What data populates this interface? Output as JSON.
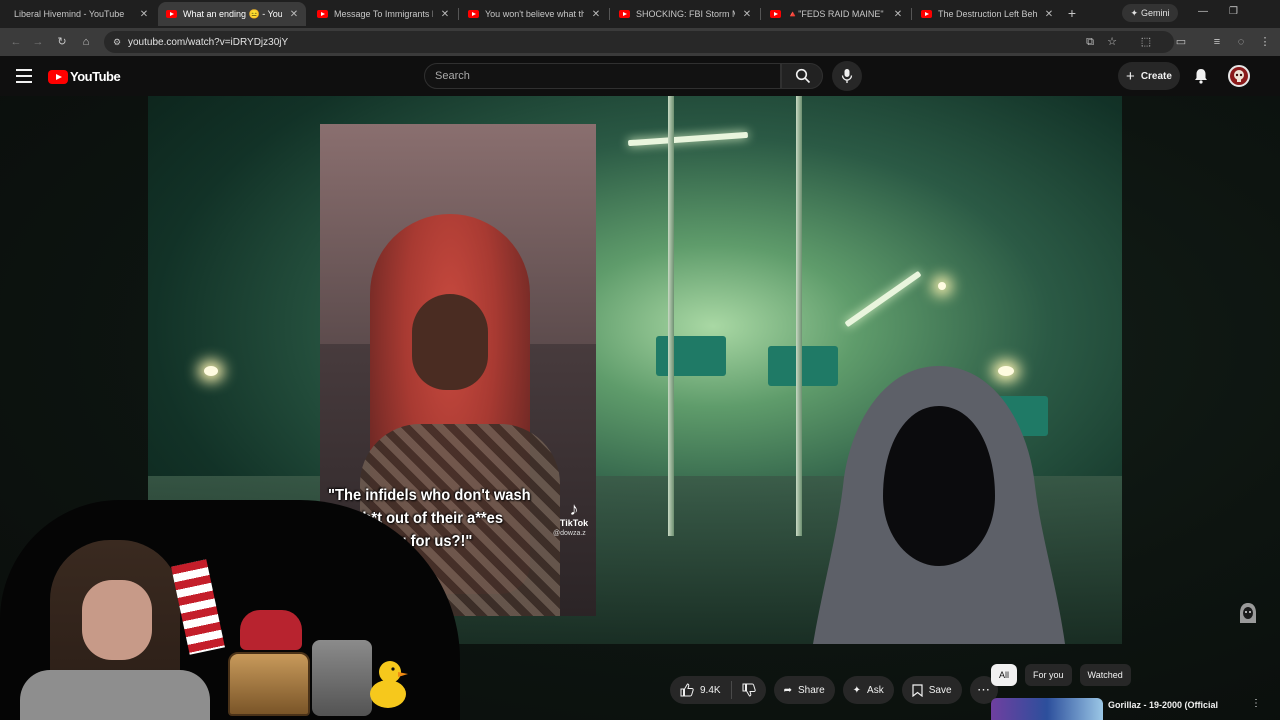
{
  "browser": {
    "tabs": [
      {
        "title": "Liberal Hivemind - YouTube"
      },
      {
        "title": "What an ending 😑 - YouTube"
      },
      {
        "title": "Message To Immigrants Mak"
      },
      {
        "title": "You won't believe what the le"
      },
      {
        "title": "SHOCKING: FBI Storm Minne"
      },
      {
        "title": "🔺\"FEDS RAID MAINE\" amid"
      },
      {
        "title": "The Destruction Left Behind"
      }
    ],
    "gemini_label": "Gemini",
    "url": "youtube.com/watch?v=iDRYDjz30jY"
  },
  "youtube": {
    "logo_text": "YouTube",
    "search_placeholder": "Search",
    "create_label": "Create"
  },
  "video": {
    "caption_lines": [
      "\"The infidels who don't wash",
      "the sh*t out of their a**es",
      "are coming for us?!\""
    ],
    "tiktok_label": "TikTok",
    "tiktok_user": "@dowza.z"
  },
  "actions": {
    "likes": "9.4K",
    "share_label": "Share",
    "ask_label": "Ask",
    "save_label": "Save"
  },
  "sidebar": {
    "chips": [
      {
        "label": "All",
        "selected": true
      },
      {
        "label": "For you",
        "selected": false
      },
      {
        "label": "Watched",
        "selected": false
      }
    ],
    "recommendation_title": "Gorillaz - 19-2000 (Official"
  },
  "colors": {
    "youtube_red": "#ff0000",
    "page_bg": "#0f0f0f",
    "pill_bg": "#272727"
  }
}
